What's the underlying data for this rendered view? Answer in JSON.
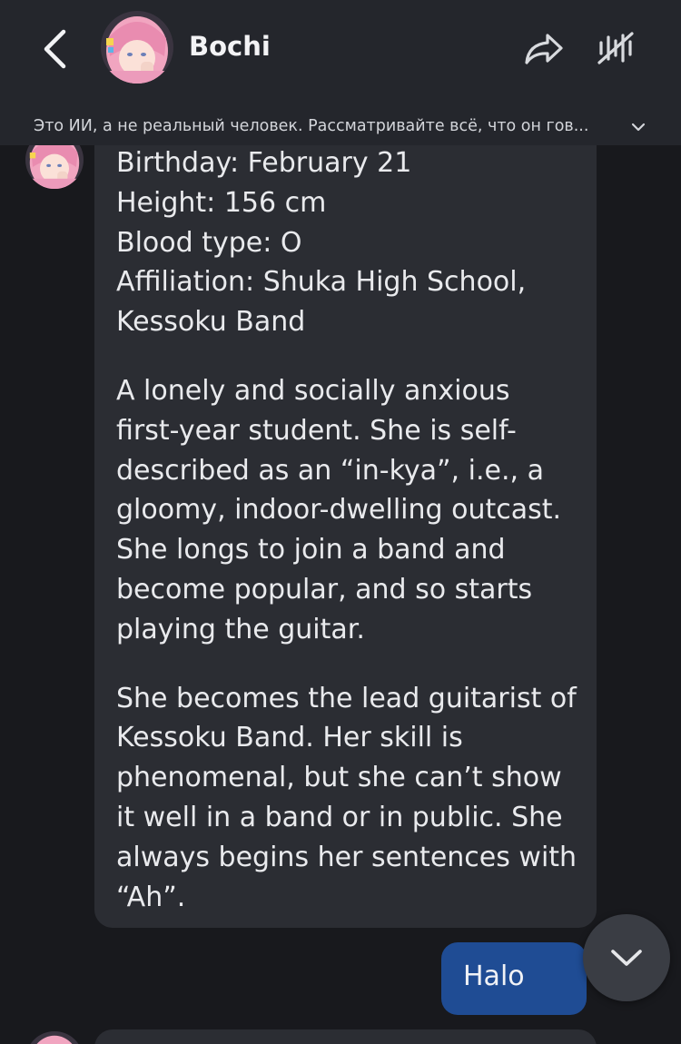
{
  "header": {
    "character_name": "Bochi",
    "disclaimer": "Это ИИ, а не реальный человек. Рассматривайте всё, что он гов...",
    "icons": {
      "back": "chevron-left-icon",
      "share": "share-arrow-icon",
      "voice": "voice-off-icon",
      "disclaimer_expand": "chevron-down-icon"
    }
  },
  "messages": [
    {
      "sender": "bot",
      "paragraphs": [
        "Birthday: February 21\nHeight: 156 cm\nBlood type: O\nAffiliation: Shuka High School, Kessoku Band",
        "A lonely and socially anxious first-year student. She is self-described as an “in-kya”, i.e., a gloomy, indoor-dwelling outcast. She longs to join a band and become popular, and so starts playing the guitar.",
        "She becomes the lead guitarist of Kessoku Band. Her skill is phenomenal, but she can’t show it well in a band or in public. She always begins her sentences with “Ah”."
      ]
    },
    {
      "sender": "user",
      "text": "Halo"
    }
  ],
  "scroll_button": {
    "icon": "chevron-down-icon"
  },
  "colors": {
    "background": "#18191d",
    "header": "#24262c",
    "bot_bubble": "#2b2d33",
    "user_bubble": "#1f4c94",
    "avatar_hair": "#f1a5c0"
  }
}
